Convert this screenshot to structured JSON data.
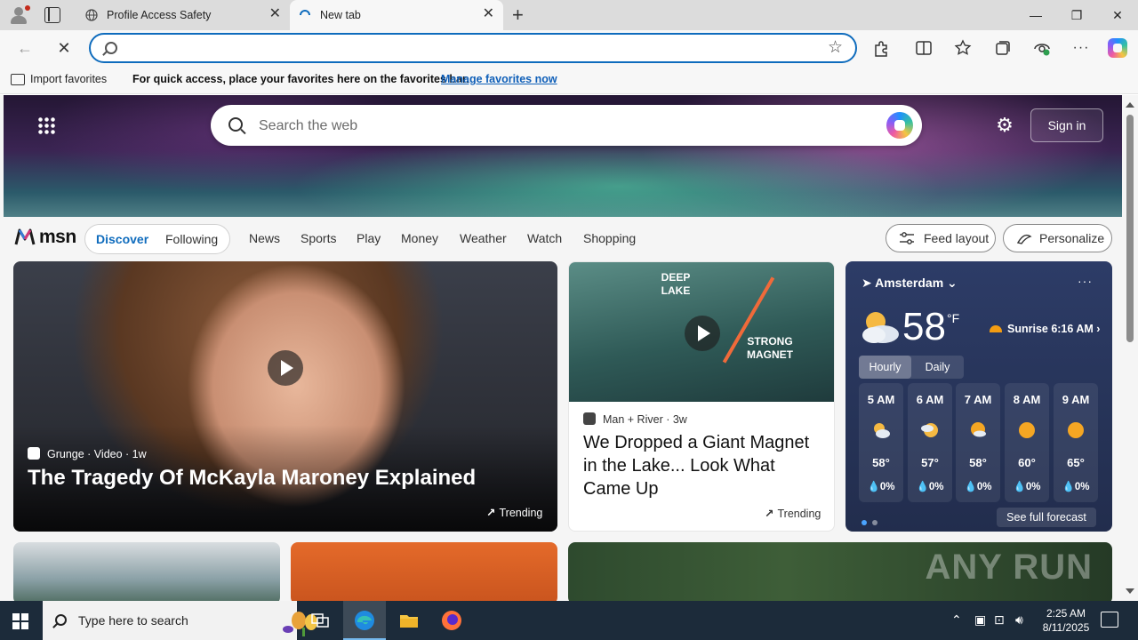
{
  "browser": {
    "tabs": [
      {
        "title": "Profile Access Safety",
        "favicon": "globe-icon"
      },
      {
        "title": "New tab",
        "favicon": "loading-spinner-icon"
      }
    ],
    "new_tab_symbol": "+",
    "close_symbol": "✕",
    "window": {
      "minimize": "—",
      "maximize": "❐",
      "close": "✕"
    },
    "address_value": "",
    "nav": {
      "back": "←",
      "stop": "✕"
    },
    "toolbar_icons": [
      "extensions-icon",
      "split-screen-icon",
      "favorites-icon",
      "collections-icon",
      "browser-essentials-icon",
      "more-icon",
      "copilot-icon"
    ]
  },
  "favorites_bar": {
    "import_label": "Import favorites",
    "message": "For quick access, place your favorites here on the favorites bar.",
    "manage_link": "Manage favorites now"
  },
  "hero": {
    "search_placeholder": "Search the web",
    "sign_in": "Sign in"
  },
  "msn": {
    "logo_text": "msn",
    "pills": [
      "Discover",
      "Following"
    ],
    "nav": [
      "News",
      "Sports",
      "Play",
      "Money",
      "Weather",
      "Watch",
      "Shopping"
    ],
    "feed_layout": "Feed layout",
    "personalize": "Personalize"
  },
  "cards": {
    "main": {
      "source": "Grunge · Video",
      "age": "1w",
      "title": "The Tragedy Of McKayla Maroney Explained",
      "badge": "Trending"
    },
    "mid": {
      "source": "Man + River",
      "age": "3w",
      "title": "We Dropped a Giant Magnet in the Lake... Look What Came Up",
      "badge": "Trending",
      "image_text_1": "DEEP LAKE",
      "image_text_2": "STRONG MAGNET"
    }
  },
  "weather": {
    "location": "Amsterdam",
    "temp": "58",
    "unit": "°F",
    "sunrise": "Sunrise 6:16 AM",
    "tabs": [
      "Hourly",
      "Daily"
    ],
    "hours": [
      {
        "time": "5 AM",
        "temp": "58°",
        "precip": "0%",
        "icon": "partly-cloudy-icon"
      },
      {
        "time": "6 AM",
        "temp": "57°",
        "precip": "0%",
        "icon": "partly-cloudy-icon"
      },
      {
        "time": "7 AM",
        "temp": "58°",
        "precip": "0%",
        "icon": "partly-sunny-icon"
      },
      {
        "time": "8 AM",
        "temp": "60°",
        "precip": "0%",
        "icon": "sunny-icon"
      },
      {
        "time": "9 AM",
        "temp": "65°",
        "precip": "0%",
        "icon": "sunny-icon"
      }
    ],
    "full_forecast": "See full forecast"
  },
  "watermark": "ANY RUN",
  "taskbar": {
    "search_placeholder": "Type here to search",
    "time": "2:25 AM",
    "date": "8/11/2025"
  },
  "colors": {
    "accent": "#0f6cbd",
    "weather_bg": "#2d3c67",
    "taskbar": "#1c2b3a"
  }
}
